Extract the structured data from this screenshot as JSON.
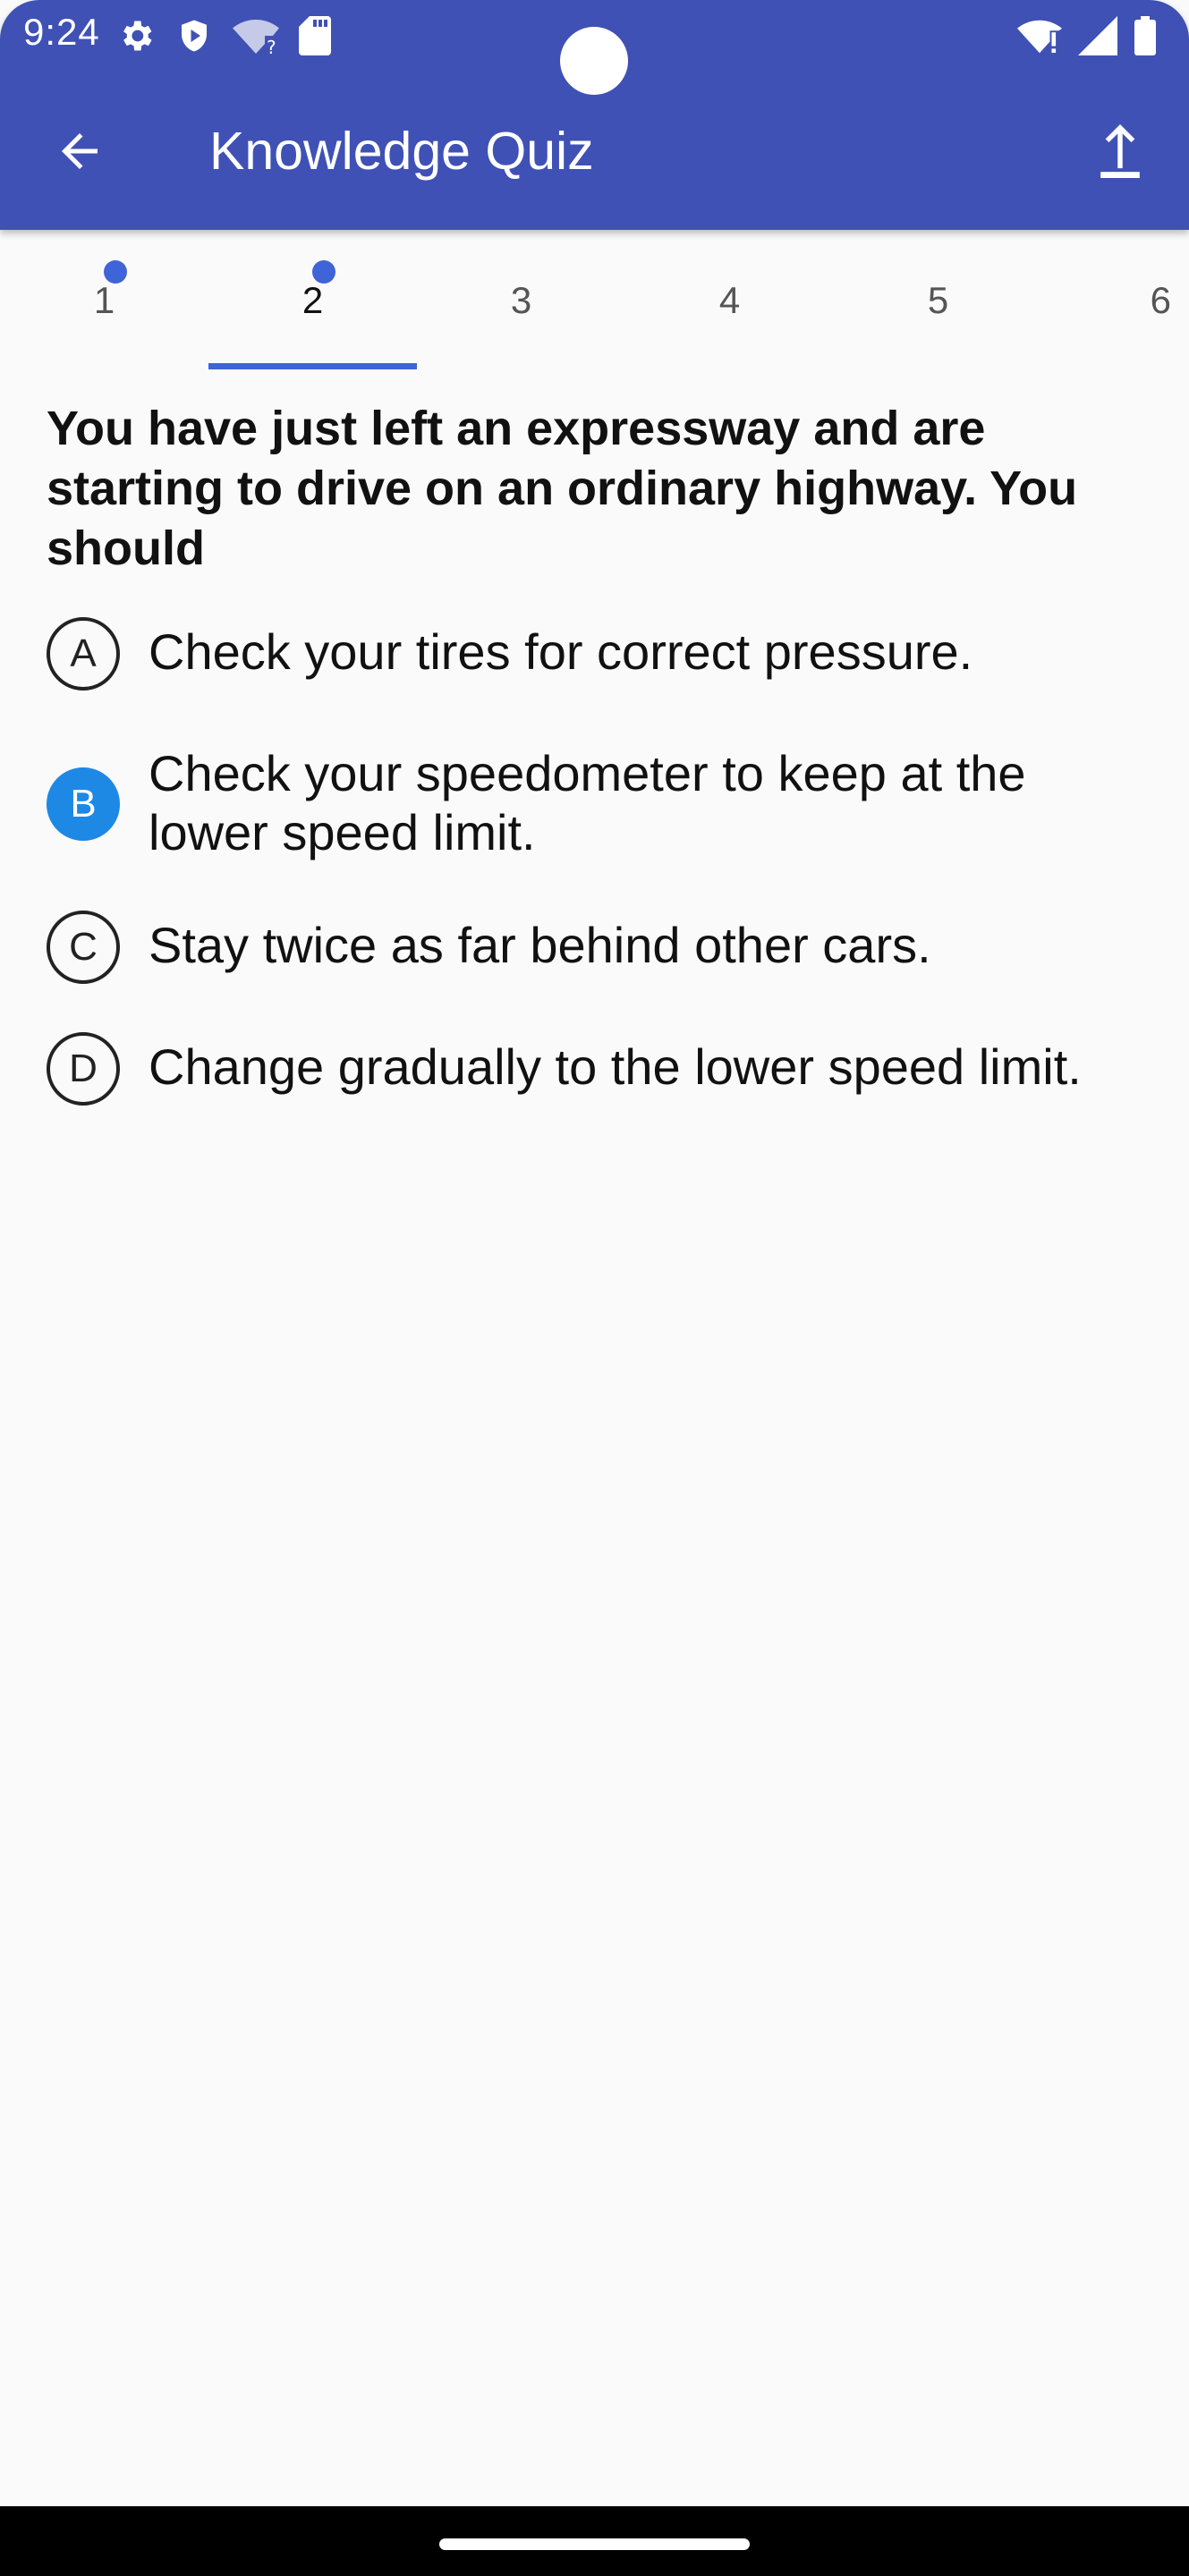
{
  "status_bar": {
    "time": "9:24",
    "left_icons": [
      "settings-icon",
      "shield-icon",
      "wifi-unknown-icon",
      "sd-card-icon"
    ],
    "right_icons": [
      "wifi-alert-icon",
      "signal-icon",
      "battery-icon"
    ]
  },
  "app_bar": {
    "title": "Knowledge Quiz",
    "back_icon": "arrow-back-icon",
    "share_icon": "upload-icon",
    "color": "#3f51b5"
  },
  "tabs": [
    {
      "label": "1",
      "answered": true,
      "active": false
    },
    {
      "label": "2",
      "answered": true,
      "active": true
    },
    {
      "label": "3",
      "answered": false,
      "active": false
    },
    {
      "label": "4",
      "answered": false,
      "active": false
    },
    {
      "label": "5",
      "answered": false,
      "active": false
    },
    {
      "label": "6",
      "answered": false,
      "active": false
    }
  ],
  "question": {
    "text": "You have just left an expressway and are starting to drive on an ordinary highway. You should",
    "options": [
      {
        "letter": "A",
        "text": "Check your tires for correct pressure.",
        "selected": false
      },
      {
        "letter": "B",
        "text": "Check your speedometer to keep at the lower speed limit.",
        "selected": true
      },
      {
        "letter": "C",
        "text": "Stay twice as far behind other cars.",
        "selected": false
      },
      {
        "letter": "D",
        "text": "Change gradually to the lower speed limit.",
        "selected": false
      }
    ]
  },
  "colors": {
    "accent": "#3f64d8",
    "selected_option": "#1e88e5"
  }
}
